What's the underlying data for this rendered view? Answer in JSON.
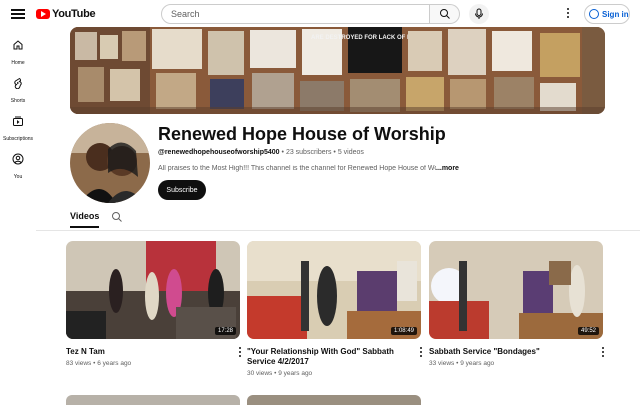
{
  "header": {
    "logo_text": "YouTube",
    "search_placeholder": "Search",
    "signin_label": "Sign in"
  },
  "sidebar": {
    "items": [
      {
        "label": "Home",
        "icon": "home-icon"
      },
      {
        "label": "Shorts",
        "icon": "shorts-icon"
      },
      {
        "label": "Subscriptions",
        "icon": "subscriptions-icon"
      },
      {
        "label": "You",
        "icon": "you-icon"
      }
    ]
  },
  "channel": {
    "name": "Renewed Hope House of Worship",
    "handle": "@renewedhopehouseofworship5400",
    "subscribers": "23 subscribers",
    "videos": "5 videos",
    "description": "All praises to the Most High!!! This channel is the channel for Renewed Hope House of Worship",
    "more_label": "...more",
    "subscribe_label": "Subscribe",
    "banner_text": "ARE DESTROYED FOR LACK OF Knowledge"
  },
  "tabs": {
    "videos_label": "Videos"
  },
  "videos": [
    {
      "title": "Tez N Tam",
      "views": "83 views",
      "age": "6 years ago",
      "duration": "17:28"
    },
    {
      "title": "\"Your Relationship With God\" Sabbath Service 4/2/2017",
      "views": "30 views",
      "age": "9 years ago",
      "duration": "1:08:49"
    },
    {
      "title": "Sabbath Service \"Bondages\"",
      "views": "33 views",
      "age": "9 years ago",
      "duration": "49:52"
    }
  ],
  "separator": "•",
  "colors": {
    "brand_red": "#ff0000",
    "link_blue": "#065fd4",
    "text_primary": "#0f0f0f",
    "text_secondary": "#606060"
  }
}
